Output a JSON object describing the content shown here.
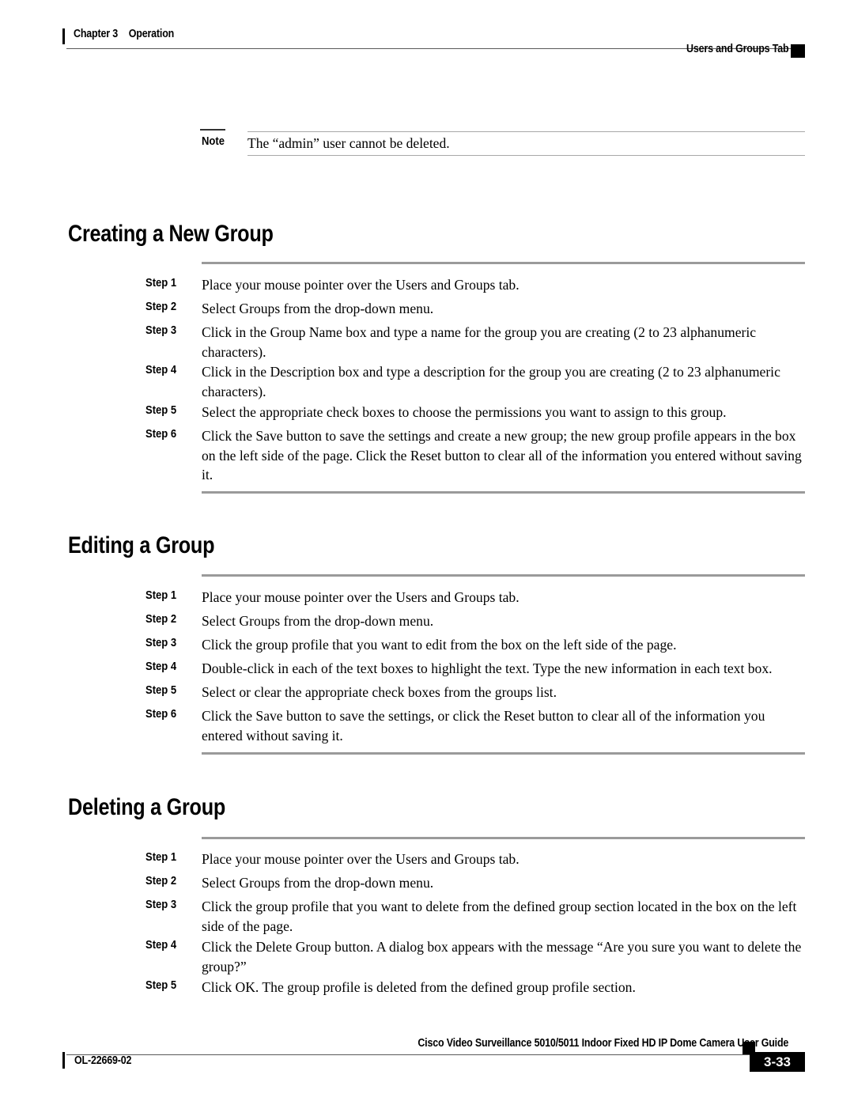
{
  "header": {
    "chapter": "Chapter 3",
    "section": "Operation",
    "running_head": "Users and Groups Tab"
  },
  "note": {
    "label": "Note",
    "text": "The “admin” user cannot be deleted."
  },
  "sections": [
    {
      "heading": "Creating a New Group",
      "steps": [
        {
          "label": "Step 1",
          "text": "Place your mouse pointer over the Users and Groups tab."
        },
        {
          "label": "Step 2",
          "text": "Select Groups from the drop-down menu."
        },
        {
          "label": "Step 3",
          "text": "Click in the Group Name box and type a name for the group you are creating (2 to 23 alphanumeric characters)."
        },
        {
          "label": "Step 4",
          "text": "Click in the Description box and type a description for the group you are creating (2 to 23 alphanumeric characters)."
        },
        {
          "label": "Step 5",
          "text": "Select the appropriate check boxes to choose the permissions you want to assign to this group."
        },
        {
          "label": "Step 6",
          "text": "Click the Save button to save the settings and create a new group; the new group profile appears in the box on the left side of the page. Click the Reset button to clear all of the information you entered without saving it."
        }
      ]
    },
    {
      "heading": "Editing a Group",
      "steps": [
        {
          "label": "Step 1",
          "text": "Place your mouse pointer over the Users and Groups tab."
        },
        {
          "label": "Step 2",
          "text": "Select Groups from the drop-down menu."
        },
        {
          "label": "Step 3",
          "text": "Click the group profile that you want to edit from the box on the left side of the page."
        },
        {
          "label": "Step 4",
          "text": "Double-click in each of the text boxes to highlight the text. Type the new information in each text box."
        },
        {
          "label": "Step 5",
          "text": "Select or clear the appropriate check boxes from the groups list."
        },
        {
          "label": "Step 6",
          "text": "Click the Save button to save the settings, or click the Reset button to clear all of the information you entered without saving it."
        }
      ]
    },
    {
      "heading": "Deleting a Group",
      "steps": [
        {
          "label": "Step 1",
          "text": "Place your mouse pointer over the Users and Groups tab."
        },
        {
          "label": "Step 2",
          "text": "Select Groups from the drop-down menu."
        },
        {
          "label": "Step 3",
          "text": "Click the group profile that you want to delete from the defined group section located in the box on the left side of the page."
        },
        {
          "label": "Step 4",
          "text": "Click the Delete Group button. A dialog box appears with the message “Are you sure you want to delete the group?”"
        },
        {
          "label": "Step 5",
          "text": "Click OK. The group profile is deleted from the defined group profile section."
        }
      ]
    }
  ],
  "footer": {
    "doc_id": "OL-22669-02",
    "guide_title": "Cisco Video Surveillance 5010/5011 Indoor Fixed HD IP Dome Camera User Guide",
    "page_number": "3-33"
  }
}
